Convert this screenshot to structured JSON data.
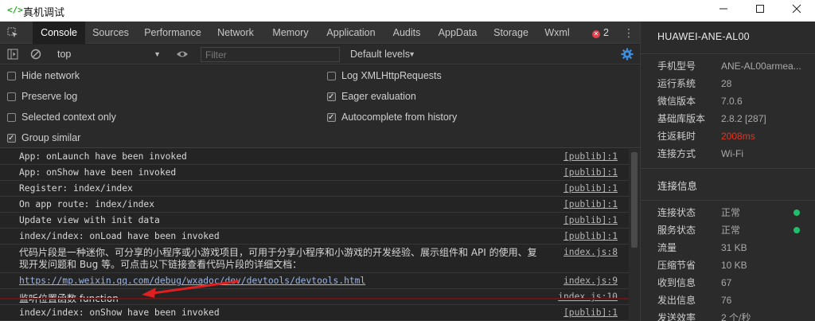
{
  "window": {
    "icon": "</>",
    "title": "真机调试",
    "minimize_icon": "minimize-icon",
    "maximize_icon": "maximize-icon",
    "close_icon": "close-icon"
  },
  "tabs": [
    "Console",
    "Sources",
    "Performance",
    "Network",
    "Memory",
    "Application",
    "Audits",
    "AppData",
    "Storage",
    "Wxml"
  ],
  "active_tab": "Console",
  "error_count": "2",
  "toolbar": {
    "context": "top",
    "filter_placeholder": "Filter",
    "filter_value": "",
    "levels": "Default levels"
  },
  "settings": {
    "hide_network": {
      "label": "Hide network",
      "checked": false
    },
    "preserve_log": {
      "label": "Preserve log",
      "checked": false
    },
    "selected_context": {
      "label": "Selected context only",
      "checked": false
    },
    "group_similar": {
      "label": "Group similar",
      "checked": true
    },
    "log_xhr": {
      "label": "Log XMLHttpRequests",
      "checked": false
    },
    "eager_eval": {
      "label": "Eager evaluation",
      "checked": true
    },
    "autocomplete": {
      "label": "Autocomplete from history",
      "checked": true
    }
  },
  "console": [
    {
      "msg": "App: onLaunch have been invoked",
      "src": "[publib]:1"
    },
    {
      "msg": "App: onShow have been invoked",
      "src": "[publib]:1"
    },
    {
      "msg": "Register: index/index",
      "src": "[publib]:1"
    },
    {
      "msg": "On app route: index/index",
      "src": "[publib]:1"
    },
    {
      "msg": "Update view with init data",
      "src": "[publib]:1"
    },
    {
      "msg": "index/index: onLoad have been invoked",
      "src": "[publib]:1"
    },
    {
      "msg": "代码片段是一种迷你、可分享的小程序或小游戏项目，可用于分享小程序和小游戏的开发经验、展示组件和 API 的使用、复现开发问题和 Bug 等。可点击以下链接查看代码片段的详细文档：",
      "src": "index.js:8"
    },
    {
      "msg": "https://mp.weixin.qq.com/debug/wxadoc/dev/devtools/devtools.html",
      "src": "index.js:9"
    },
    {
      "msg": "监听位置函数 function",
      "src": "index.js:10"
    },
    {
      "msg": "index/index: onShow have been invoked",
      "src": "[publib]:1"
    }
  ],
  "device": {
    "name": "HUAWEI-ANE-AL00",
    "fields": [
      {
        "key": "手机型号",
        "value": "ANE-AL00armea..."
      },
      {
        "key": "运行系统",
        "value": "28"
      },
      {
        "key": "微信版本",
        "value": "7.0.6"
      },
      {
        "key": "基础库版本",
        "value": "2.8.2 [287]"
      },
      {
        "key": "往返耗时",
        "value": "2008ms"
      },
      {
        "key": "连接方式",
        "value": "Wi-Fi"
      }
    ]
  },
  "connection": {
    "title": "连接信息",
    "fields": [
      {
        "key": "连接状态",
        "value": "正常"
      },
      {
        "key": "服务状态",
        "value": "正常"
      },
      {
        "key": "流量",
        "value": "31 KB"
      },
      {
        "key": "压缩节省",
        "value": "10 KB"
      },
      {
        "key": "收到信息",
        "value": "67"
      },
      {
        "key": "发出信息",
        "value": "76"
      },
      {
        "key": "发送效率",
        "value": "2 个/秒"
      }
    ]
  },
  "colors": {
    "latency_red": "#e8331d",
    "status_green": "#1fc06b",
    "link_blue": "#9bb5e6"
  }
}
